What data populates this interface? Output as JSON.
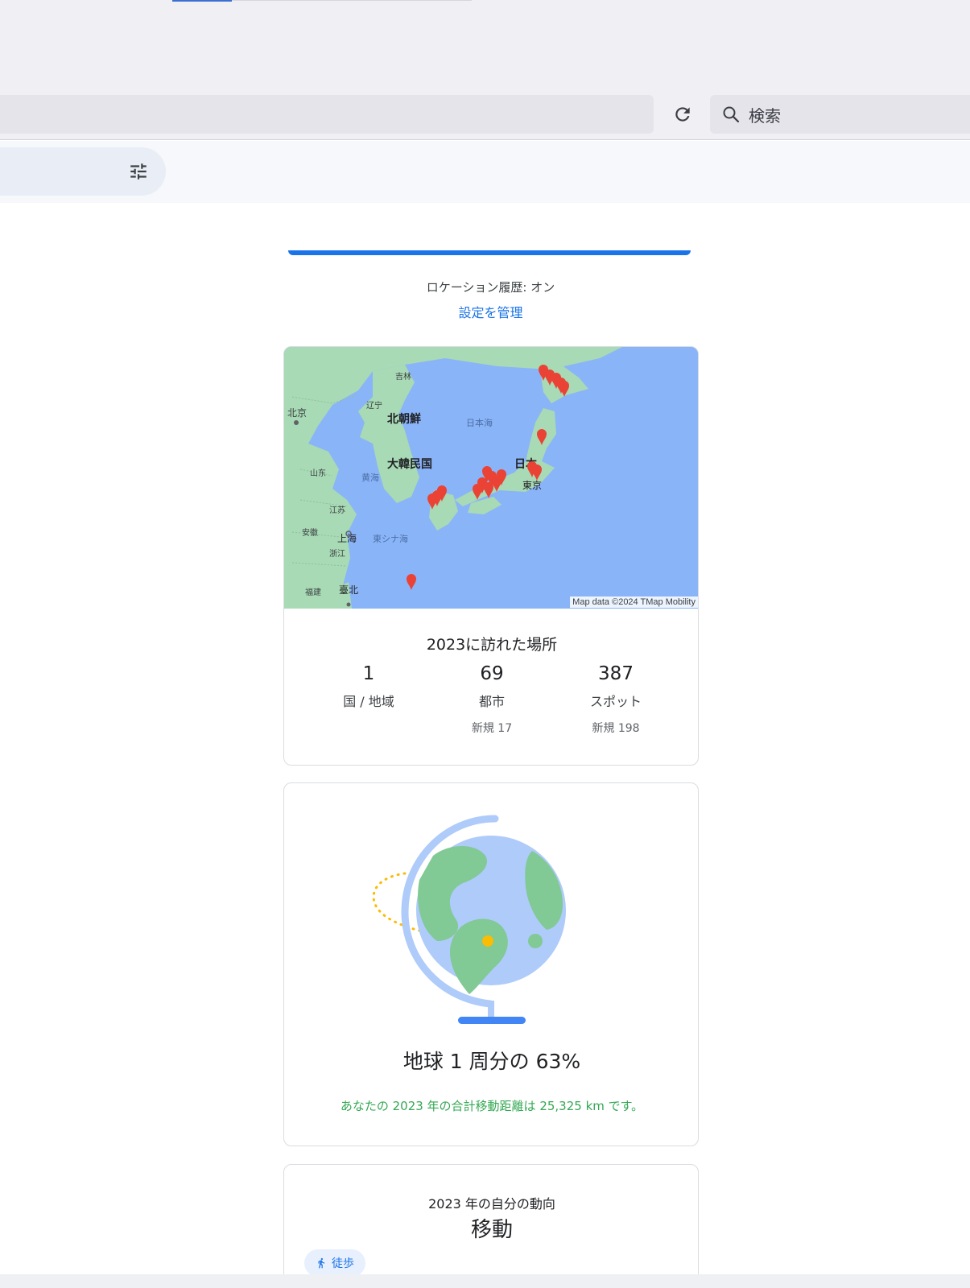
{
  "browser": {
    "search_placeholder": "検索"
  },
  "main": {
    "location_status": "ロケーション履歴: オン",
    "manage_link": "設定を管理"
  },
  "map_card": {
    "attribution": "Map data ©2024 TMap Mobility",
    "labels": {
      "beijing": "北京",
      "jilin": "吉林",
      "liaoning": "辽宁",
      "north_korea": "北朝鮮",
      "sea_of_japan": "日本海",
      "south_korea": "大韓民国",
      "shandong": "山东",
      "yellow_sea": "黄海",
      "japan": "日本",
      "tokyo": "東京",
      "jiangsu": "江苏",
      "anhui": "安徽",
      "shanghai": "上海",
      "east_china_sea": "東シナ海",
      "zhejiang": "浙江",
      "fujian": "福建",
      "taipei": "臺北"
    },
    "title": "2023に訪れた場所",
    "stats": [
      {
        "value": "1",
        "label": "国 / 地域",
        "sub": ""
      },
      {
        "value": "69",
        "label": "都市",
        "sub": "新規 17"
      },
      {
        "value": "387",
        "label": "スポット",
        "sub": "新規 198"
      }
    ]
  },
  "globe_card": {
    "title": "地球 1 周分の 63%",
    "distance_text": "あなたの 2023 年の合計移動距離は 25,325 km です。",
    "progress_fraction": 0.63
  },
  "trend_card": {
    "subtitle": "2023 年の自分の動向",
    "title": "移動",
    "chip_label": "徒歩",
    "chip_icon": "walking-icon"
  },
  "colors": {
    "accent": "#1a73e8",
    "pin": "#ea4335",
    "land": "#a8dab5",
    "sea": "#8ab4f8",
    "distance_text": "#34a853"
  }
}
